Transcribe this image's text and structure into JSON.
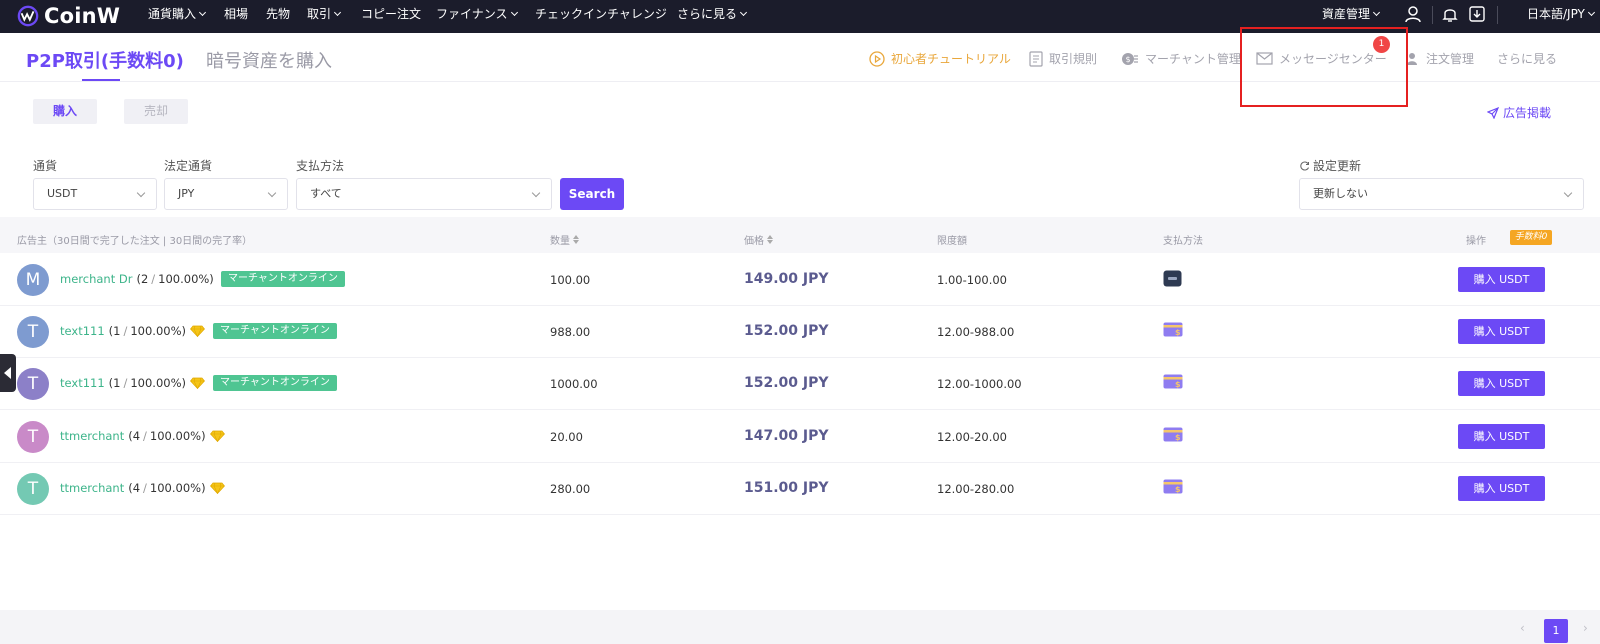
{
  "topnav": {
    "logo": "CoinW",
    "items": [
      {
        "label": "通貨購入",
        "dropdown": true
      },
      {
        "label": "相場",
        "dropdown": false
      },
      {
        "label": "先物",
        "dropdown": false
      },
      {
        "label": "取引",
        "dropdown": true
      },
      {
        "label": "コピー注文",
        "dropdown": false
      },
      {
        "label": "ファイナンス",
        "dropdown": true
      },
      {
        "label": "チェックインチャレンジ",
        "dropdown": false
      },
      {
        "label": "さらに見る",
        "dropdown": true
      }
    ],
    "assets": "資産管理",
    "language": "日本語/JPY"
  },
  "header": {
    "tab_p2p": "P2P取引(手数料0)",
    "tab_buy_crypto": "暗号資産を購入",
    "links": {
      "tutorial": "初心者チュートリアル",
      "rules": "取引規則",
      "merchant": "マーチャント管理",
      "messages": "メッセージセンター",
      "orders": "注文管理",
      "more": "さらに見る"
    },
    "message_badge": "1"
  },
  "toggles": {
    "buy": "購入",
    "sell": "売却"
  },
  "post_ad": "広告掲載",
  "filters": {
    "currency_label": "通貨",
    "currency_value": "USDT",
    "fiat_label": "法定通貨",
    "fiat_value": "JPY",
    "payment_label": "支払方法",
    "payment_value": "すべて",
    "search": "Search",
    "refresh_label": "設定更新",
    "refresh_value": "更新しない"
  },
  "table": {
    "headers": {
      "advertiser": "広告主（30日間で完了した注文 | 30日間の完了率）",
      "quantity": "数量",
      "price": "価格",
      "limit": "限度額",
      "payment": "支払方法",
      "action": "操作"
    },
    "fee_tag": "手数料0",
    "rows": [
      {
        "initial": "M",
        "avatar_color": "#7e9bd0",
        "name": "merchant Dr",
        "orders": "(2",
        "rate": "100.00%)",
        "gem": false,
        "online": "マーチャントオンライン",
        "qty": "100.00",
        "price": "149.00 JPY",
        "limit": "1.00-100.00",
        "payment_icon": "bank-card-dark",
        "button": "購入 USDT"
      },
      {
        "initial": "T",
        "avatar_color": "#7e9bd0",
        "name": "text111",
        "orders": "(1",
        "rate": "100.00%)",
        "gem": true,
        "online": "マーチャントオンライン",
        "qty": "988.00",
        "price": "152.00 JPY",
        "limit": "12.00-988.00",
        "payment_icon": "cash-card",
        "button": "購入 USDT"
      },
      {
        "initial": "T",
        "avatar_color": "#8c80c8",
        "name": "text111",
        "orders": "(1",
        "rate": "100.00%)",
        "gem": true,
        "online": "マーチャントオンライン",
        "qty": "1000.00",
        "price": "152.00 JPY",
        "limit": "12.00-1000.00",
        "payment_icon": "cash-card",
        "button": "購入 USDT"
      },
      {
        "initial": "T",
        "avatar_color": "#c98ac8",
        "name": "ttmerchant",
        "orders": "(4",
        "rate": "100.00%)",
        "gem": true,
        "online": "",
        "qty": "20.00",
        "price": "147.00 JPY",
        "limit": "12.00-20.00",
        "payment_icon": "cash-card",
        "button": "購入 USDT"
      },
      {
        "initial": "T",
        "avatar_color": "#74c9b3",
        "name": "ttmerchant",
        "orders": "(4",
        "rate": "100.00%)",
        "gem": true,
        "online": "",
        "qty": "280.00",
        "price": "151.00 JPY",
        "limit": "12.00-280.00",
        "payment_icon": "cash-card",
        "button": "購入 USDT"
      }
    ]
  },
  "pagination": {
    "current": "1",
    "prev": "‹",
    "next": "›"
  },
  "colors": {
    "accent": "#6c49f5",
    "online_green": "#4fc592",
    "merchant_green": "#3db48a",
    "fee_orange": "#f5a623",
    "badge_red": "#f04646"
  }
}
